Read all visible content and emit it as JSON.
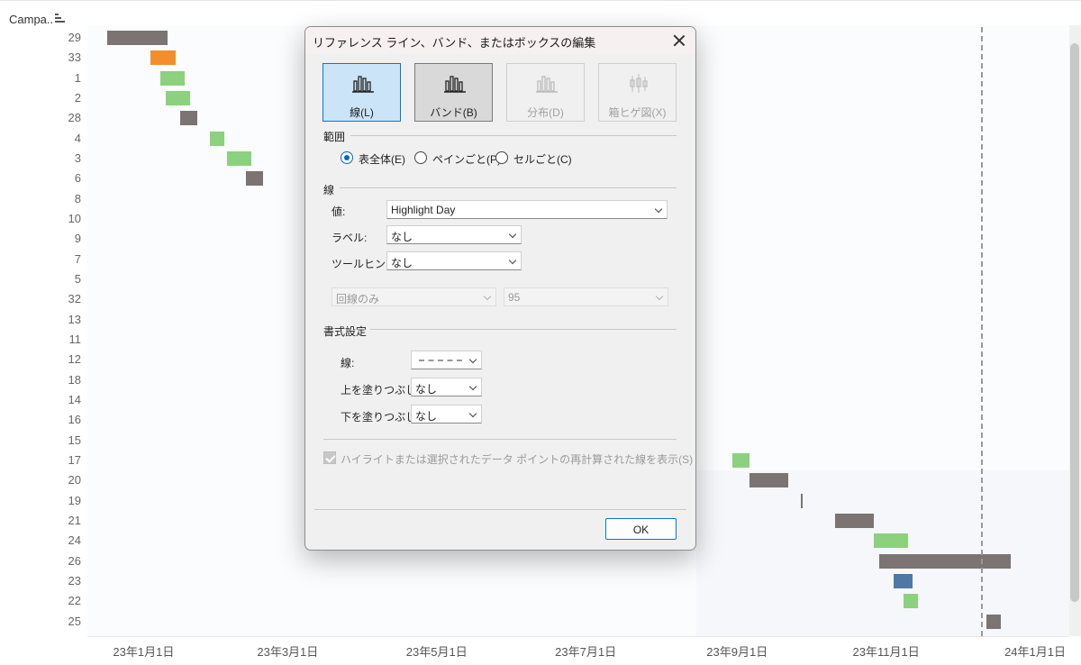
{
  "sheet": {
    "field_title": "Campa..",
    "sort_icon": "sort-descending-icon"
  },
  "chart_data": {
    "type": "gantt",
    "row_labels": [
      "29",
      "33",
      "1",
      "2",
      "28",
      "4",
      "3",
      "6",
      "8",
      "10",
      "9",
      "7",
      "5",
      "32",
      "13",
      "11",
      "12",
      "18",
      "14",
      "16",
      "15",
      "17",
      "20",
      "19",
      "21",
      "24",
      "26",
      "23",
      "22",
      "25"
    ],
    "x_tick_labels": [
      "23年1月1日",
      "23年3月1日",
      "23年5月1日",
      "23年7月1日",
      "23年9月1日",
      "23年11月1日",
      "24年1月1日"
    ],
    "x_ticks": [
      "2023-01-01",
      "2023-03-01",
      "2023-05-01",
      "2023-07-01",
      "2023-09-01",
      "2023-11-01",
      "2024-01-01"
    ],
    "x_range": [
      "2022-12-09",
      "2024-01-15"
    ],
    "colors": {
      "gray": "#7b7472",
      "orange": "#f28e2b",
      "green": "#8cd17d",
      "blue": "#4e79a7"
    },
    "bars": [
      {
        "row": "29",
        "start": "2022-12-17",
        "end": "2023-01-11",
        "color": "gray"
      },
      {
        "row": "33",
        "start": "2023-01-04",
        "end": "2023-01-14",
        "color": "orange"
      },
      {
        "row": "1",
        "start": "2023-01-08",
        "end": "2023-01-18",
        "color": "green"
      },
      {
        "row": "2",
        "start": "2023-01-10",
        "end": "2023-01-20",
        "color": "green"
      },
      {
        "row": "28",
        "start": "2023-01-16",
        "end": "2023-01-23",
        "color": "gray"
      },
      {
        "row": "4",
        "start": "2023-01-28",
        "end": "2023-02-03",
        "color": "green"
      },
      {
        "row": "3",
        "start": "2023-02-04",
        "end": "2023-02-14",
        "color": "green"
      },
      {
        "row": "6",
        "start": "2023-02-12",
        "end": "2023-02-19",
        "color": "gray"
      },
      {
        "row": "17",
        "start": "2023-08-30",
        "end": "2023-09-06",
        "color": "green"
      },
      {
        "row": "20",
        "start": "2023-09-06",
        "end": "2023-09-22",
        "color": "gray"
      },
      {
        "row": "19",
        "start": "2023-09-27",
        "end": "2023-09-28",
        "color": "gray"
      },
      {
        "row": "21",
        "start": "2023-10-11",
        "end": "2023-10-27",
        "color": "gray"
      },
      {
        "row": "24",
        "start": "2023-10-27",
        "end": "2023-11-10",
        "color": "green"
      },
      {
        "row": "26",
        "start": "2023-10-29",
        "end": "2023-12-22",
        "color": "gray"
      },
      {
        "row": "23",
        "start": "2023-11-04",
        "end": "2023-11-12",
        "color": "blue"
      },
      {
        "row": "22",
        "start": "2023-11-08",
        "end": "2023-11-14",
        "color": "green"
      },
      {
        "row": "25",
        "start": "2023-12-12",
        "end": "2023-12-18",
        "color": "gray"
      }
    ],
    "reference_line": {
      "x": "2023-12-10",
      "style": "dashed"
    },
    "grid": false
  },
  "dialog": {
    "title": "リファレンス ライン、バンド、またはボックスの編集",
    "close_icon": "close-icon",
    "types": [
      {
        "label": "線(L)",
        "icon": "reference-line-icon",
        "state": "selected"
      },
      {
        "label": "バンド(B)",
        "icon": "reference-band-icon",
        "state": "active"
      },
      {
        "label": "分布(D)",
        "icon": "distribution-icon",
        "state": "disabled"
      },
      {
        "label": "箱ヒゲ図(X)",
        "icon": "box-plot-icon",
        "state": "disabled"
      }
    ],
    "scope": {
      "label": "範囲",
      "options": [
        {
          "label": "表全体(E)",
          "checked": true
        },
        {
          "label": "ペインごと(P)",
          "checked": false
        },
        {
          "label": "セルごと(C)",
          "checked": false
        }
      ]
    },
    "line": {
      "label": "線",
      "value_label": "値:",
      "value": "Highlight Day",
      "label_label": "ラベル:",
      "label_value": "なし",
      "tooltip_label": "ツールヒント:",
      "tooltip_value": "なし",
      "interval_value": "回線のみ",
      "confidence_value": "95"
    },
    "format": {
      "label": "書式設定",
      "line_label": "線:",
      "fill_above_label": "上を塗りつぶし:",
      "fill_above_value": "なし",
      "fill_below_label": "下を塗りつぶし:",
      "fill_below_value": "なし"
    },
    "recalc_checkbox": {
      "label": "ハイライトまたは選択されたデータ ポイントの再計算された線を表示(S)",
      "checked": true,
      "disabled": true
    },
    "ok_label": "OK"
  }
}
